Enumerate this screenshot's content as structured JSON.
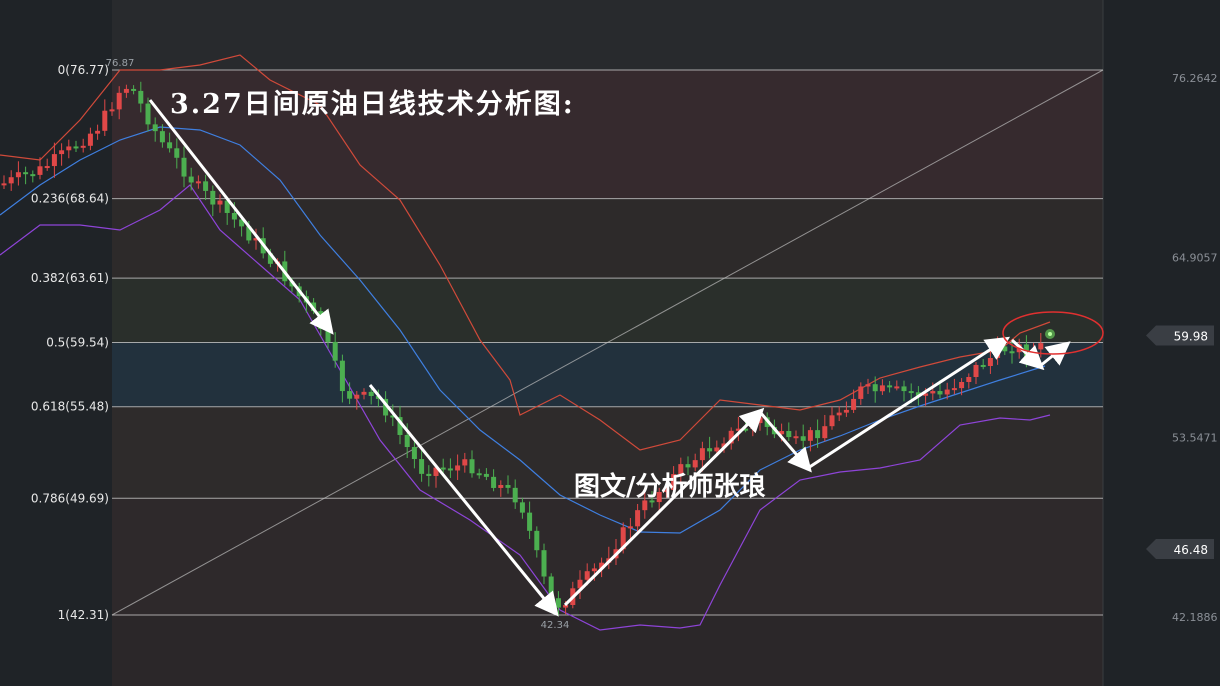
{
  "chart_data": {
    "type": "candlestick",
    "title": "3.27日间原油日线技术分析图:",
    "watermark": "图文/分析师张琅",
    "fib_levels": [
      {
        "label": "0(76.77)",
        "ratio": 0,
        "price": 76.77
      },
      {
        "label": "0.236(68.64)",
        "ratio": 0.236,
        "price": 68.64
      },
      {
        "label": "0.382(63.61)",
        "ratio": 0.382,
        "price": 63.61
      },
      {
        "label": "0.5(59.54)",
        "ratio": 0.5,
        "price": 59.54
      },
      {
        "label": "0.618(55.48)",
        "ratio": 0.618,
        "price": 55.48
      },
      {
        "label": "0.786(49.69)",
        "ratio": 0.786,
        "price": 49.69
      },
      {
        "label": "1(42.31)",
        "ratio": 1,
        "price": 42.31
      }
    ],
    "right_axis": [
      "76.2642",
      "64.9057",
      "53.5471",
      "42.1886"
    ],
    "price_tags": [
      {
        "text": "59.98",
        "price": 59.98
      },
      {
        "text": "46.48",
        "price": 46.48
      }
    ],
    "high_label": "76.87",
    "low_label": "42.34",
    "y_range": [
      39.5,
      79.0
    ],
    "colors": {
      "up": "#e04848",
      "down": "#4caf50",
      "middle_band": "#3f7fe0",
      "upper_band": "#d04a3a",
      "lower_band": "#8e44d8",
      "arrow": "#ffffff",
      "highlight": "#e03030"
    }
  }
}
